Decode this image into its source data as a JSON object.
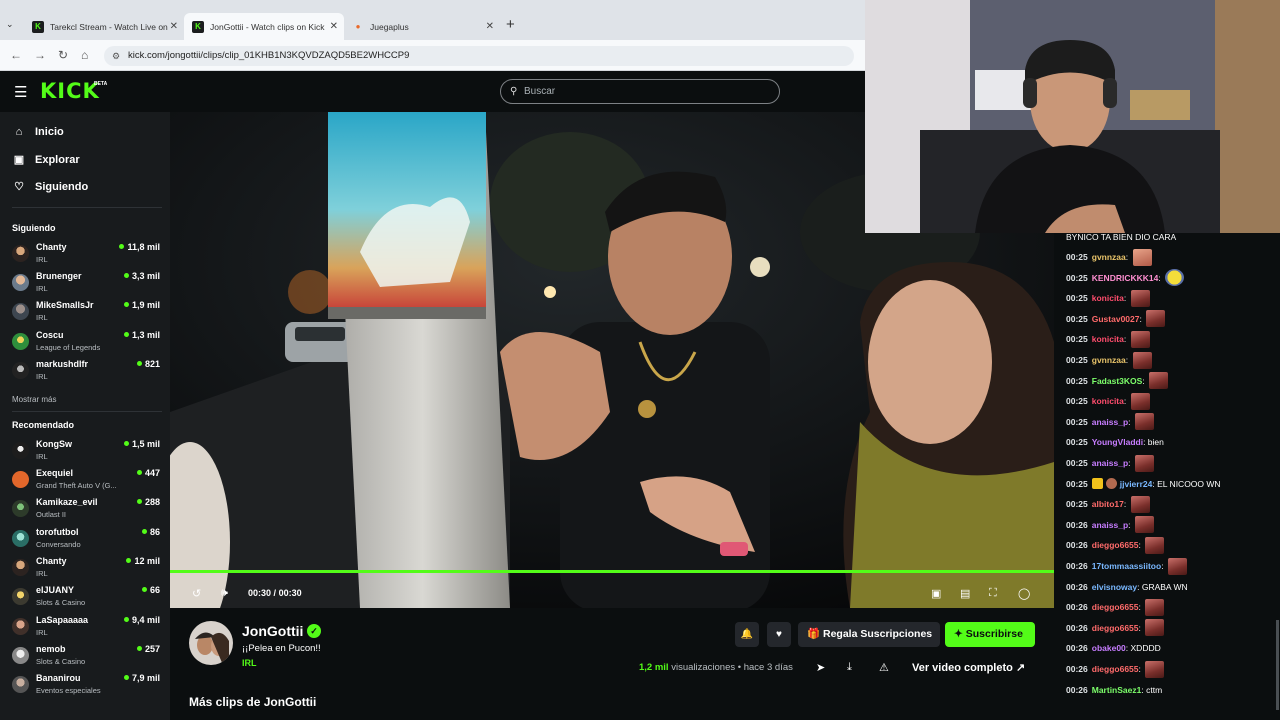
{
  "browser": {
    "tabs": [
      {
        "title": "Tarekcl Stream - Watch Live on",
        "favicon": "kick-icon",
        "active": false
      },
      {
        "title": "JonGottii - Watch clips on Kick",
        "favicon": "kick-icon",
        "active": true
      },
      {
        "title": "Juegaplus",
        "favicon": "juegaplus-icon",
        "active": false
      }
    ],
    "url": "kick.com/jongottii/clips/clip_01KHB1N3KQVDZAQD5BE2WHCCP9"
  },
  "header": {
    "logo": "KICK",
    "beta": "BETA",
    "search_placeholder": "Buscar"
  },
  "sidebar": {
    "nav": [
      {
        "label": "Inicio",
        "icon": "home-icon"
      },
      {
        "label": "Explorar",
        "icon": "browse-icon"
      },
      {
        "label": "Siguiendo",
        "icon": "heart-icon"
      }
    ],
    "following_title": "Siguiendo",
    "following": [
      {
        "name": "Chanty",
        "category": "IRL",
        "viewers": "11,8 mil"
      },
      {
        "name": "Brunenger",
        "category": "IRL",
        "viewers": "3,3 mil"
      },
      {
        "name": "MikeSmallsJr",
        "category": "IRL",
        "viewers": "1,9 mil"
      },
      {
        "name": "Coscu",
        "category": "League of Legends",
        "viewers": "1,3 mil"
      },
      {
        "name": "markushdlfr",
        "category": "IRL",
        "viewers": "821"
      }
    ],
    "show_more": "Mostrar más",
    "recommended_title": "Recomendado",
    "recommended": [
      {
        "name": "KongSw",
        "category": "IRL",
        "viewers": "1,5 mil"
      },
      {
        "name": "Exequiel",
        "category": "Grand Theft Auto V (G...",
        "viewers": "447"
      },
      {
        "name": "Kamikaze_evil",
        "category": "Outlast II",
        "viewers": "288"
      },
      {
        "name": "torofutbol",
        "category": "Conversando",
        "viewers": "86"
      },
      {
        "name": "Chanty",
        "category": "IRL",
        "viewers": "12 mil"
      },
      {
        "name": "elJUANY",
        "category": "Slots & Casino",
        "viewers": "66"
      },
      {
        "name": "LaSapaaaaa",
        "category": "IRL",
        "viewers": "9,4 mil"
      },
      {
        "name": "nemob",
        "category": "Slots & Casino",
        "viewers": "257"
      },
      {
        "name": "Bananirou",
        "category": "Eventos especiales",
        "viewers": "7,9 mil"
      }
    ]
  },
  "player": {
    "time_current": "00:30",
    "time_separator": "/",
    "time_total": "00:30",
    "progress": 1.0
  },
  "clip": {
    "streamer": "JonGottii",
    "title": "¡¡Pelea en Pucon!!",
    "category": "IRL",
    "gift_label": "Regala Suscripciones",
    "subscribe_label": "Suscribirse",
    "views_count": "1,2 mil",
    "views_label": "visualizaciones",
    "age": "hace 3 días",
    "full_video_label": "Ver video completo",
    "more_clips": "Más clips de JonGottii"
  },
  "chat": {
    "top_line": "BYNICO TA BIEN DIO CARA",
    "messages": [
      {
        "time": "00:25",
        "user": "gvnnzaa",
        "color": "#e9c46a",
        "text": "",
        "emote": "hand"
      },
      {
        "time": "00:25",
        "user": "KENDRICKKK14",
        "color": "#ff8fd1",
        "text": "",
        "emote": "minion"
      },
      {
        "time": "00:25",
        "user": "konicita",
        "color": "#ff4d6d",
        "text": "",
        "emote": "face"
      },
      {
        "time": "00:25",
        "user": "Gustav0027",
        "color": "#ff6b6b",
        "text": "",
        "emote": "face"
      },
      {
        "time": "00:25",
        "user": "konicita",
        "color": "#ff4d6d",
        "text": "",
        "emote": "face"
      },
      {
        "time": "00:25",
        "user": "gvnnzaa",
        "color": "#e9c46a",
        "text": "",
        "emote": "face"
      },
      {
        "time": "00:25",
        "user": "Fadast3KOS",
        "color": "#7dff6b",
        "text": "",
        "emote": "face"
      },
      {
        "time": "00:25",
        "user": "konicita",
        "color": "#ff4d6d",
        "text": "",
        "emote": "face"
      },
      {
        "time": "00:25",
        "user": "anaiss_p",
        "color": "#c77dff",
        "text": "",
        "emote": "face"
      },
      {
        "time": "00:25",
        "user": "YoungVladdi",
        "color": "#c77dff",
        "text": "bien",
        "emote": ""
      },
      {
        "time": "00:25",
        "user": "anaiss_p",
        "color": "#c77dff",
        "text": "",
        "emote": "face"
      },
      {
        "time": "00:25",
        "user": "jjvierr24",
        "color": "#7ab8ff",
        "text": "EL NICOOO WN",
        "emote": "",
        "badges": true
      },
      {
        "time": "00:25",
        "user": "albito17",
        "color": "#ff6b6b",
        "text": "",
        "emote": "face"
      },
      {
        "time": "00:26",
        "user": "anaiss_p",
        "color": "#c77dff",
        "text": "",
        "emote": "face"
      },
      {
        "time": "00:26",
        "user": "dieggo6655",
        "color": "#ff6b6b",
        "text": "",
        "emote": "face"
      },
      {
        "time": "00:26",
        "user": "17tommaassiitoo",
        "color": "#7ab8ff",
        "text": "",
        "emote": "face"
      },
      {
        "time": "00:26",
        "user": "elvisnoway",
        "color": "#7ab8ff",
        "text": "GRABA WN",
        "emote": ""
      },
      {
        "time": "00:26",
        "user": "dieggo6655",
        "color": "#ff6b6b",
        "text": "",
        "emote": "face"
      },
      {
        "time": "00:26",
        "user": "dieggo6655",
        "color": "#ff6b6b",
        "text": "",
        "emote": "face"
      },
      {
        "time": "00:26",
        "user": "obake00",
        "color": "#c77dff",
        "text": "XDDDD",
        "emote": ""
      },
      {
        "time": "00:26",
        "user": "dieggo6655",
        "color": "#ff6b6b",
        "text": "",
        "emote": "face"
      },
      {
        "time": "00:26",
        "user": "MartinSaez1",
        "color": "#7dff6b",
        "text": "cttm",
        "emote": ""
      }
    ]
  },
  "colors": {
    "accent": "#53fc18",
    "background": "#0b0e0f",
    "sidebar": "#181b1d"
  }
}
